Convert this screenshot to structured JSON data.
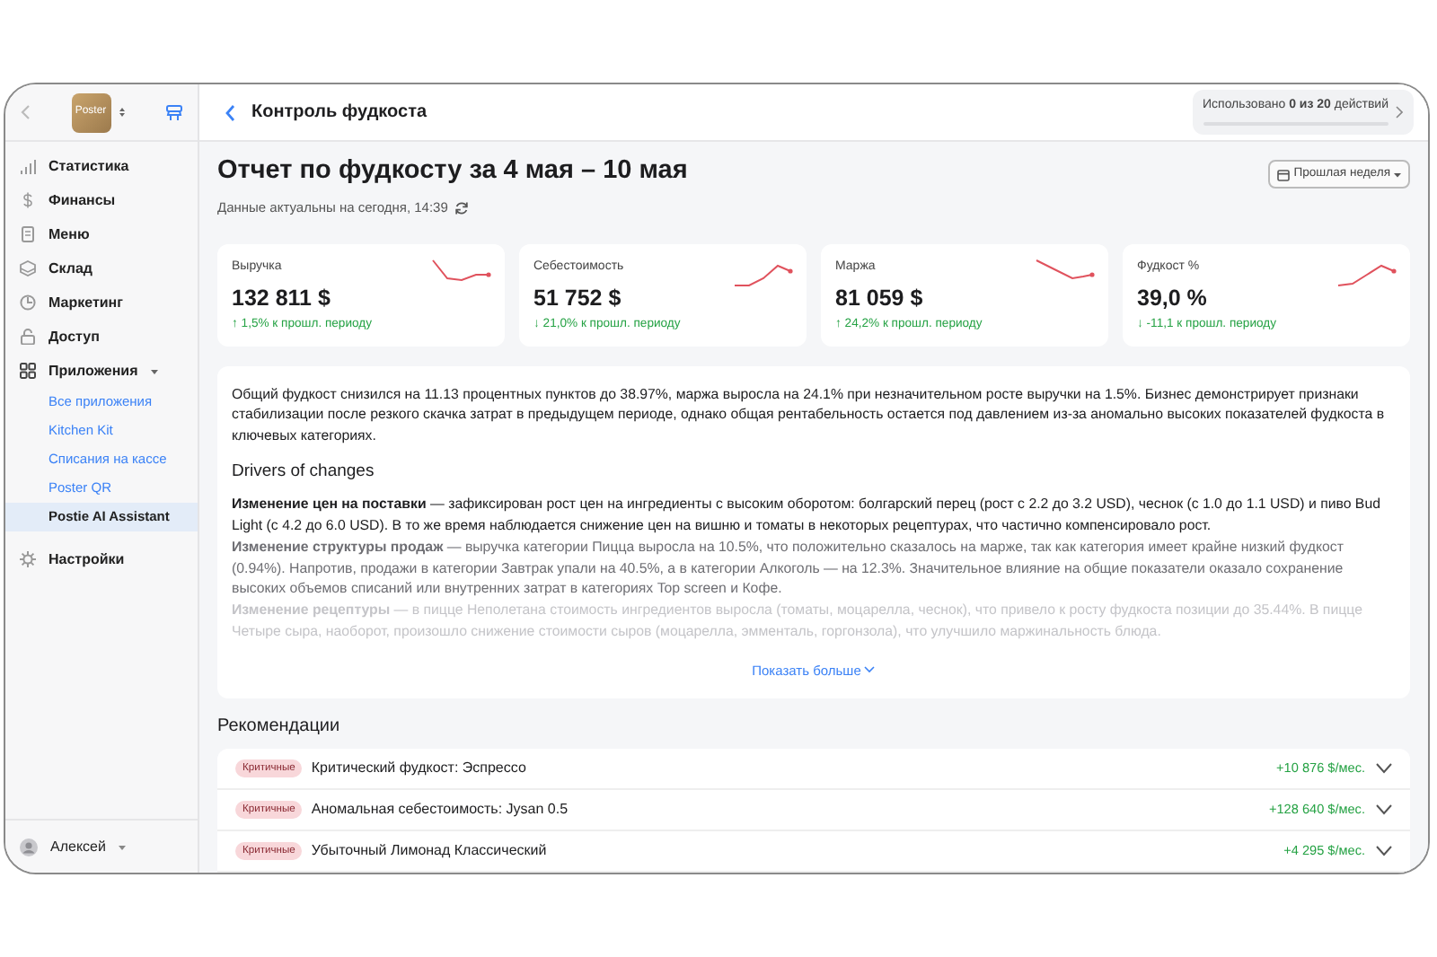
{
  "sidebar": {
    "logo": "Poster",
    "items": [
      {
        "label": "Статистика",
        "selected": false
      },
      {
        "label": "Финансы",
        "selected": false
      },
      {
        "label": "Меню",
        "selected": false
      },
      {
        "label": "Склад",
        "selected": false
      },
      {
        "label": "Маркетинг",
        "selected": false
      },
      {
        "label": "Доступ",
        "selected": false
      },
      {
        "label": "Приложения",
        "selected": false,
        "expanded": true,
        "children": [
          {
            "label": "Все приложения",
            "selected": false
          },
          {
            "label": "Kitchen Kit",
            "selected": false
          },
          {
            "label": "Списания на кассе",
            "selected": false
          },
          {
            "label": "Poster QR",
            "selected": false
          },
          {
            "label": "Postie AI Assistant",
            "selected": true
          }
        ]
      },
      {
        "label": "Настройки",
        "selected": false
      }
    ],
    "user": "Алексей"
  },
  "header": {
    "title": "Контроль фудкоста",
    "usage": {
      "text": "Использовано **0 из 20** действий",
      "level": 0
    }
  },
  "report": {
    "title": "Отчет по фудкосту за 4 мая – 10 мая",
    "updated": "Данные актуальны на сегодня, 14:39",
    "period": "Прошлая неделя"
  },
  "metrics": [
    {
      "label": "Выручка",
      "value": "132 811 $",
      "delta": "↑ 1,5% к прошл. периоду"
    },
    {
      "label": "Себестоимость",
      "value": "51 752 $",
      "delta": "↓ 21,0% к прошл. периоду"
    },
    {
      "label": "Маржа",
      "value": "81 059 $",
      "delta": "↑ 24,2% к прошл. периоду"
    },
    {
      "label": "Фудкост %",
      "value": "39,0 %",
      "delta": "↓ -11,1 к прошл. периоду"
    }
  ],
  "summary": {
    "text": "Общий фудкост снизился на 11.13 процентных пунктов до 38.97%, маржа выросла на 24.1% при незначительном росте выручки на 1.5%. Бизнес демонстрирует признаки стабилизации после резкого скачка затрат в предыдущем периоде, однако общая рентабельность остается под давлением из-за аномально высоких показателей фудкоста в ключевых категориях.",
    "heading": "Drivers of changes",
    "drivers": [
      "**Изменение цен на поставки** — зафиксирован рост цен на ингредиенты с высоким оборотом: болгарский перец (рост с 2.2 до 3.2 USD), чеснок (с 1.0 до 1.1 USD) и пиво Bud Light (с 4.2 до 6.0 USD). В то же время наблюдается снижение цен на вишню и томаты в некоторых рецептурах, что частично компенсировало рост.",
      "**Изменение структуры продаж** — выручка категории Пицца выросла на 10.5%, что положительно сказалось на марже, так как категория имеет крайне низкий фудкост (0.94%). Напротив, продажи в категории Завтрак упали на 40.5%, а в категории Алкоголь — на 12.3%. Значительное влияние на общие показатели оказало сохранение высоких объемов списаний или внутренних затрат в категориях Top screen и Кофе.",
      "**Изменение рецептуры** — в пицце Неполетана стоимость ингредиентов выросла (томаты, моцарелла, чеснок), что привело к росту фудкоста позиции до 35.44%. В пицце Четыре сыра, наоборот, произошло снижение стоимости сыров (моцарелла, эмменталь, горгонзола), что улучшило маржинальность блюда."
    ],
    "more": "Показать больше"
  },
  "recommendations": {
    "title": "Рекомендации",
    "items": [
      {
        "badge": "Критичные",
        "title": "Критический фудкост: Эспрессо",
        "amount": "+10 876 $/мес."
      },
      {
        "badge": "Критичные",
        "title": "Аномальная себестоимость: Jysan 0.5",
        "amount": "+128 640 $/мес."
      },
      {
        "badge": "Критичные",
        "title": "Убыточный Лимонад Классический",
        "amount": "+4 295 $/мес."
      }
    ]
  }
}
